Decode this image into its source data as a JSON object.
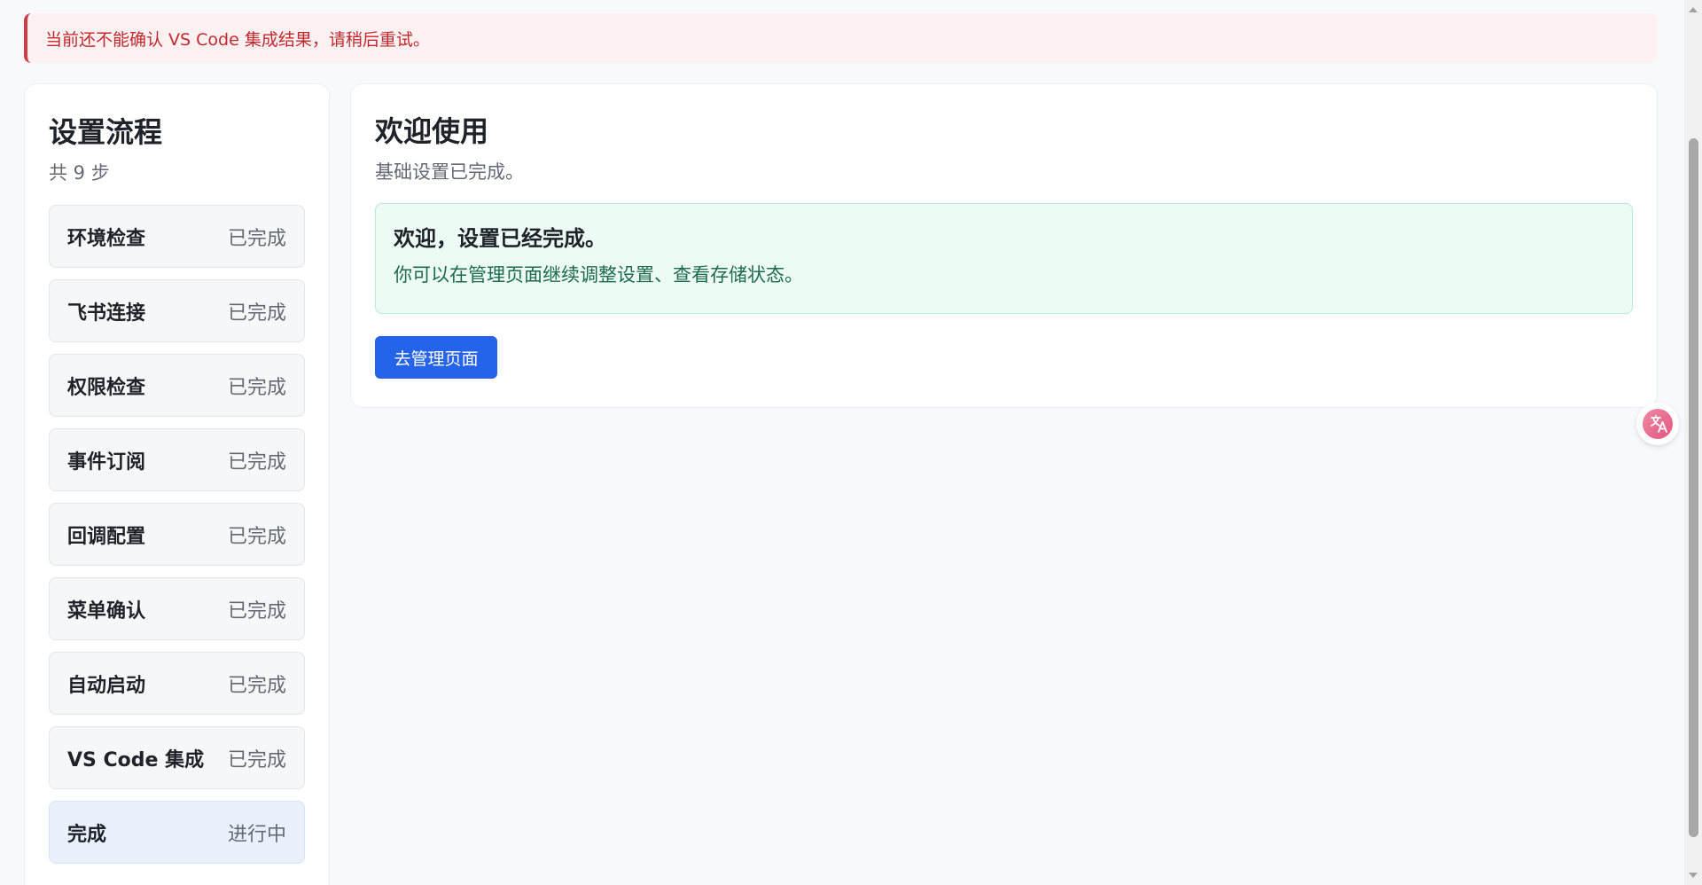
{
  "alert": {
    "message": "当前还不能确认 VS Code 集成结果，请稍后重试。"
  },
  "sidebar": {
    "title": "设置流程",
    "subtitle": "共 9 步",
    "steps": [
      {
        "name": "环境检查",
        "status": "已完成"
      },
      {
        "name": "飞书连接",
        "status": "已完成"
      },
      {
        "name": "权限检查",
        "status": "已完成"
      },
      {
        "name": "事件订阅",
        "status": "已完成"
      },
      {
        "name": "回调配置",
        "status": "已完成"
      },
      {
        "name": "菜单确认",
        "status": "已完成"
      },
      {
        "name": "自动启动",
        "status": "已完成"
      },
      {
        "name": "VS Code 集成",
        "status": "已完成"
      },
      {
        "name": "完成",
        "status": "进行中"
      }
    ]
  },
  "main": {
    "title": "欢迎使用",
    "subtitle": "基础设置已完成。",
    "success": {
      "title": "欢迎，设置已经完成。",
      "description": "你可以在管理页面继续调整设置、查看存储状态。"
    },
    "button_label": "去管理页面"
  },
  "floating": {
    "icon": "translate-icon"
  },
  "colors": {
    "accent": "#2563eb",
    "error": "#c2282f",
    "success_bg": "#edfbf5",
    "active_step_bg": "#eaf1fd"
  }
}
